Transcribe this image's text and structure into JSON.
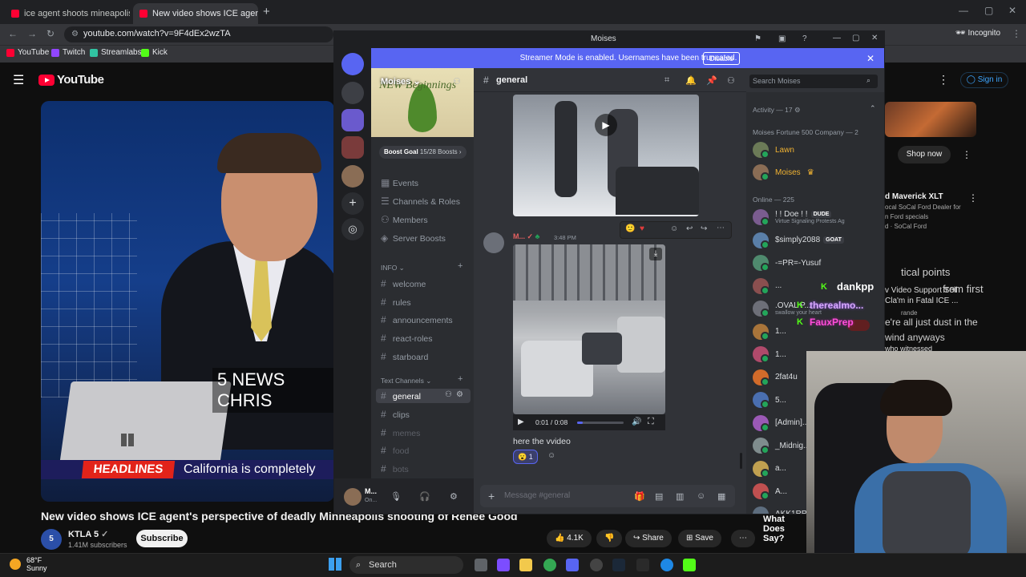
{
  "browser": {
    "tabs": [
      {
        "title": "ice agent shoots mineapolis an"
      },
      {
        "title": "New video shows ICE agent's p"
      }
    ],
    "url": "youtube.com/watch?v=9F4dEx2wzTA",
    "bookmarks": [
      "YouTube",
      "Twitch",
      "Streamlabs",
      "Kick"
    ],
    "profile": "Incognito"
  },
  "youtube": {
    "logo": "YouTube",
    "sign_in": "Sign in",
    "video_title": "New video shows ICE agent's perspective of deadly Minneapolis shooting of Renee Good",
    "channel": "KTLA 5",
    "channel_initial": "5",
    "subscribers": "1.41M subscribers",
    "subscribe": "Subscribe",
    "likes": "4.1K",
    "share": "Share",
    "save": "Save",
    "lower_third": "5 NEWS CHRIS",
    "headline_tag": "HEADLINES",
    "headline_text": "California is completely",
    "ad": {
      "shop_now": "Shop now",
      "title": "d Maverick XLT",
      "line1": "ocal SoCal Ford Dealer for",
      "line2": "n Ford specials",
      "line3": "d · SoCal Ford"
    },
    "rec_lines": [
      "v Video Support Sell",
      "Cla'm in Fatal ICE ...",
      "rande",
      "who witnessed"
    ],
    "overlay_lines": [
      "tical points",
      "from first",
      "e're all just dust in the",
      "wind anyways"
    ]
  },
  "discord": {
    "window_title": "Moises",
    "streamer_banner": "Streamer Mode is enabled. Usernames have been truncated.",
    "disable": "Disable",
    "server_name": "Moises",
    "banner_text": "NEW Beginnings",
    "boost_goal": "Boost Goal",
    "boost_count": "15/28 Boosts",
    "nav": [
      "Events",
      "Channels & Roles",
      "Members",
      "Server Boosts"
    ],
    "info_category": "INFO",
    "info_channels": [
      "welcome",
      "rules",
      "announcements",
      "react-roles",
      "starboard"
    ],
    "text_category": "Text Channels",
    "text_channels": [
      "general",
      "clips",
      "memes",
      "food",
      "bots"
    ],
    "user": {
      "name": "M...",
      "status": "On..."
    },
    "channel_header": "general",
    "search_placeholder": "Search Moises",
    "message": {
      "author": "M...",
      "time": "3:48 PM",
      "video_time": "0:01 / 0:08",
      "text": "here the vvideo",
      "reaction_count": "1"
    },
    "input_placeholder": "Message #general",
    "members_panel": {
      "activity": "Activity — 17",
      "group1": "Moises Fortune 500 Company — 2",
      "group1_members": [
        "Lawn",
        "Moises"
      ],
      "online": "Online — 225",
      "online_members": [
        {
          "name": "! ! Doe ! !",
          "tag": "DUDE",
          "sub": "Virtue Signaling Protests Ag"
        },
        {
          "name": "$simply2088",
          "tag": "GOAT",
          "sub": ""
        },
        {
          "name": "-=PR=-Yusuf",
          "tag": "",
          "sub": ""
        },
        {
          "name": "...",
          "tag": "",
          "sub": ""
        },
        {
          "name": ".OVAL P...",
          "tag": "",
          "sub": "swallow your heart"
        },
        {
          "name": "1...",
          "tag": "",
          "sub": ""
        },
        {
          "name": "1...",
          "tag": "",
          "sub": ""
        },
        {
          "name": "2fat4u",
          "tag": "",
          "sub": ""
        },
        {
          "name": "5...",
          "tag": "",
          "sub": ""
        },
        {
          "name": "[Admin]...",
          "tag": "",
          "sub": ""
        },
        {
          "name": "_Midnig...",
          "tag": "",
          "sub": ""
        },
        {
          "name": "a...",
          "tag": "",
          "sub": ""
        },
        {
          "name": "A...",
          "tag": "",
          "sub": ""
        },
        {
          "name": "AKK1RR",
          "tag": "",
          "sub": ""
        }
      ]
    }
  },
  "stream_overlay": {
    "chat1": "dankpp",
    "chat2": "therealmo...",
    "chat3": "FauxPrep",
    "what_does": "What Does Say?"
  },
  "taskbar": {
    "temp": "68°F",
    "condition": "Sunny",
    "search": "Search"
  },
  "colors": {
    "discord_blurple": "#5865f2",
    "youtube_red": "#ff0033",
    "online_green": "#23a55a"
  }
}
